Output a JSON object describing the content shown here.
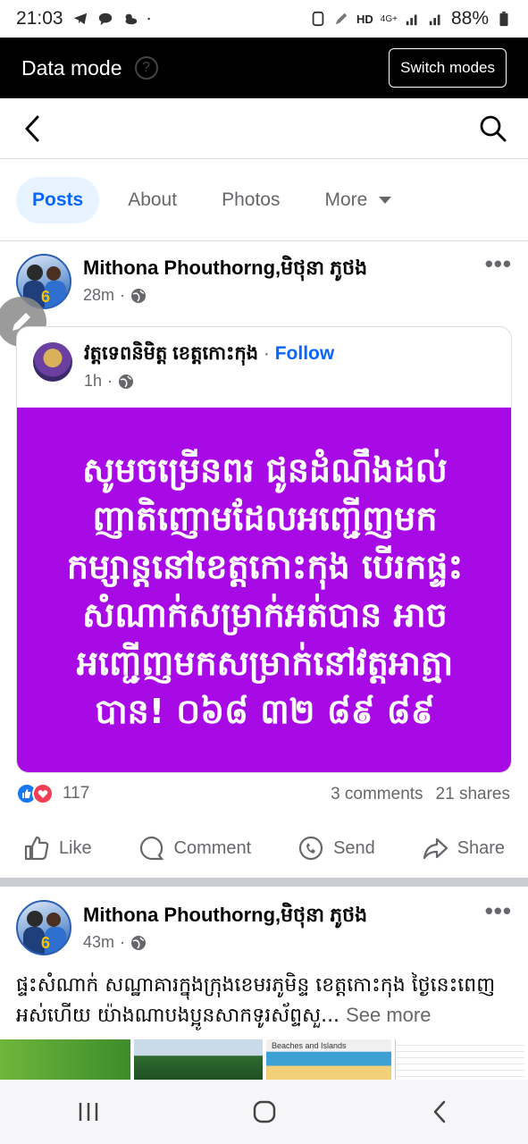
{
  "status_bar": {
    "time": "21:03",
    "battery": "88%",
    "network": "HD",
    "signal_label": "4G+"
  },
  "data_mode_bar": {
    "title": "Data mode",
    "switch_label": "Switch modes"
  },
  "tabs": [
    {
      "label": "Posts",
      "active": true
    },
    {
      "label": "About",
      "active": false
    },
    {
      "label": "Photos",
      "active": false
    },
    {
      "label": "More",
      "active": false
    }
  ],
  "posts": [
    {
      "author": "Mithona Phouthorng,មិថុនា ភូថង",
      "time": "28m",
      "shared": {
        "page_name": "វត្តទេពនិមិត្ត ខេត្តកោះកុង",
        "separator": "·",
        "follow_label": "Follow",
        "time": "1h",
        "text": "សូមចម្រើនពរ ជូនដំណឹងដល់ញាតិញោមដែលអញ្ជើញមកកម្សាន្តនៅខេត្តកោះកុង បើរកផ្ទះសំណាក់សម្រាក់អត់បាន អាចអញ្ជើញមកសម្រាក់នៅវត្តអាត្មាបាន! ០៦៨ ៣២ ៨៩ ៨៩",
        "background_color": "#a80ae6"
      },
      "reaction_count": "117",
      "comments": "3 comments",
      "shares": "21 shares"
    },
    {
      "author": "Mithona Phouthorng,មិថុនា ភូថង",
      "time": "43m",
      "text": "ផ្ទះសំណាក់ សណ្ឋាគារក្នុងក្រុងខេមរភូមិន្ទ ខេត្តកោះកុង ថ្ងៃនេះពេញអស់ហើយ យ៉ាងណាបងប្អូនសាកទូរស័ព្ទសួ...",
      "see_more": "See more",
      "thumb_caption_3": "Beaches and Islands"
    }
  ],
  "actions": {
    "like": "Like",
    "comment": "Comment",
    "send": "Send",
    "share": "Share"
  },
  "colors": {
    "facebook_blue": "#0866ff",
    "active_tab_bg": "#e7f3ff",
    "secondary_text": "#65676b"
  }
}
